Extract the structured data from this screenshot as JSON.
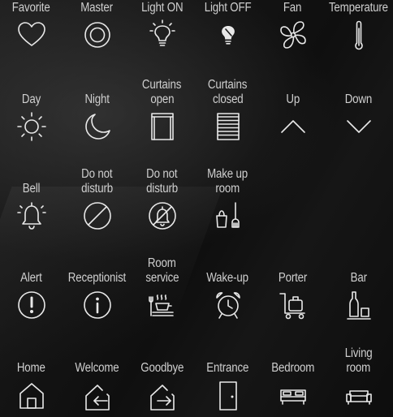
{
  "tiles": [
    {
      "id": "favorite",
      "label": "Favorite",
      "icon": "heart-icon"
    },
    {
      "id": "master",
      "label": "Master",
      "icon": "target-icon"
    },
    {
      "id": "light-on",
      "label": "Light ON",
      "icon": "bulb-on-icon"
    },
    {
      "id": "light-off",
      "label": "Light OFF",
      "icon": "bulb-off-icon"
    },
    {
      "id": "fan",
      "label": "Fan",
      "icon": "fan-icon"
    },
    {
      "id": "temperature",
      "label": "Temperature",
      "icon": "thermometer-icon"
    },
    {
      "id": "day",
      "label": "Day",
      "icon": "sun-icon"
    },
    {
      "id": "night",
      "label": "Night",
      "icon": "moon-icon"
    },
    {
      "id": "curtains-open",
      "label": "Curtains\nopen",
      "icon": "curtains-open-icon"
    },
    {
      "id": "curtains-closed",
      "label": "Curtains\nclosed",
      "icon": "curtains-closed-icon"
    },
    {
      "id": "up",
      "label": "Up",
      "icon": "chevron-up-icon"
    },
    {
      "id": "down",
      "label": "Down",
      "icon": "chevron-down-icon"
    },
    {
      "id": "bell",
      "label": "Bell",
      "icon": "bell-icon"
    },
    {
      "id": "do-not-disturb-1",
      "label": "Do not\ndisturb",
      "icon": "no-entry-icon"
    },
    {
      "id": "do-not-disturb-2",
      "label": "Do not\ndisturb",
      "icon": "bell-off-icon"
    },
    {
      "id": "make-up-room",
      "label": "Make up\nroom",
      "icon": "cleaning-icon"
    },
    null,
    null,
    {
      "id": "alert",
      "label": "Alert",
      "icon": "alert-icon"
    },
    {
      "id": "receptionist",
      "label": "Receptionist",
      "icon": "info-icon"
    },
    {
      "id": "room-service",
      "label": "Room\nservice",
      "icon": "room-service-icon"
    },
    {
      "id": "wake-up",
      "label": "Wake-up",
      "icon": "alarm-clock-icon"
    },
    {
      "id": "porter",
      "label": "Porter",
      "icon": "luggage-cart-icon"
    },
    {
      "id": "bar",
      "label": "Bar",
      "icon": "bottle-glass-icon"
    },
    {
      "id": "home",
      "label": "Home",
      "icon": "home-icon"
    },
    {
      "id": "welcome",
      "label": "Welcome",
      "icon": "enter-house-icon"
    },
    {
      "id": "goodbye",
      "label": "Goodbye",
      "icon": "exit-house-icon"
    },
    {
      "id": "entrance",
      "label": "Entrance",
      "icon": "door-icon"
    },
    {
      "id": "bedroom",
      "label": "Bedroom",
      "icon": "bed-icon"
    },
    {
      "id": "living-room",
      "label": "Living\nroom",
      "icon": "sofa-icon"
    }
  ],
  "colors": {
    "text": "#cfcfcf",
    "icon": "#e8e8e8",
    "background": "#101010"
  }
}
